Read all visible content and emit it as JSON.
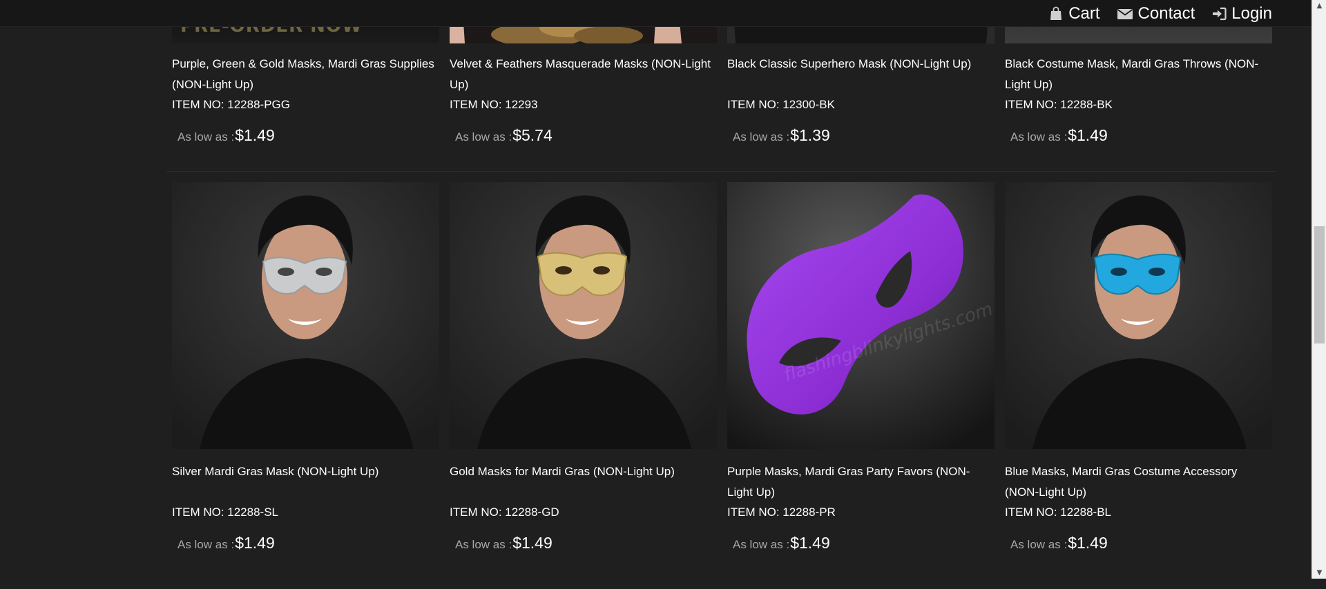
{
  "header": {
    "nav": [
      {
        "label": "Cart",
        "icon": "shopping-bag-icon"
      },
      {
        "label": "Contact",
        "icon": "envelope-icon"
      },
      {
        "label": "Login",
        "icon": "sign-in-icon"
      }
    ]
  },
  "products_row1": [
    {
      "title": "Purple, Green & Gold Masks, Mardi Gras Supplies (NON-Light Up)",
      "item_no": "ITEM NO: 12288-PGG",
      "price_label": "As low as :",
      "price": "$1.49",
      "banner": "PRE-ORDER NOW"
    },
    {
      "title": "Velvet & Feathers Masquerade Masks (NON-Light Up)",
      "item_no": "ITEM NO: 12293",
      "price_label": "As low as :",
      "price": "$5.74"
    },
    {
      "title": "Black Classic Superhero Mask (NON-Light Up)",
      "item_no": "ITEM NO: 12300-BK",
      "price_label": "As low as :",
      "price": "$1.39"
    },
    {
      "title": "Black Costume Mask, Mardi Gras Throws (NON-Light Up)",
      "item_no": "ITEM NO: 12288-BK",
      "price_label": "As low as :",
      "price": "$1.49"
    }
  ],
  "products_row2": [
    {
      "title": "Silver Mardi Gras Mask (NON-Light Up)",
      "item_no": "ITEM NO: 12288-SL",
      "price_label": "As low as :",
      "price": "$1.49",
      "mask_color": "#c9cbcd"
    },
    {
      "title": "Gold Masks for Mardi Gras (NON-Light Up)",
      "item_no": "ITEM NO: 12288-GD",
      "price_label": "As low as :",
      "price": "$1.49",
      "mask_color": "#d8c078"
    },
    {
      "title": "Purple Masks, Mardi Gras Party Favors (NON-Light Up)",
      "item_no": "ITEM NO: 12288-PR",
      "price_label": "As low as :",
      "price": "$1.49",
      "mask_color": "#8e2fd6",
      "watermark": "flashingblinkylights.com"
    },
    {
      "title": "Blue Masks, Mardi Gras Costume Accessory (NON-Light Up)",
      "item_no": "ITEM NO: 12288-BL",
      "price_label": "As low as :",
      "price": "$1.49",
      "mask_color": "#22a8de"
    }
  ]
}
